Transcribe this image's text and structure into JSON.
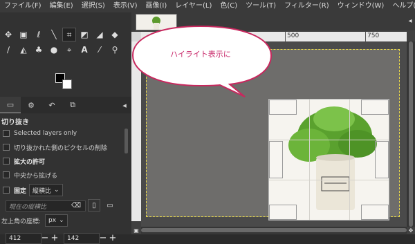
{
  "menubar": {
    "items": [
      "ファイル(F)",
      "編集(E)",
      "選択(S)",
      "表示(V)",
      "画像(I)",
      "レイヤー(L)",
      "色(C)",
      "ツール(T)",
      "フィルター(R)",
      "ウィンドウ(W)",
      "ヘルプ(H)"
    ]
  },
  "tool_options": {
    "title": "切り抜き",
    "selected_layers_only": "Selected layers only",
    "delete_cropped_pixels": "切り抜かれた側のピクセルの削除",
    "allow_growing": "拡大の許可",
    "expand_from_center": "中央から拡げる",
    "fixed_label": "固定",
    "fixed_value": "縦横比",
    "aspect_placeholder": "現在の縦横比",
    "position_label": "左上角の座標:",
    "unit": "px",
    "pos_x": "412",
    "pos_y": "142"
  },
  "ruler": {
    "label_500": "500",
    "label_750": "750"
  },
  "callout": {
    "text": "ハイライト表示に",
    "stroke_color": "#c8285e"
  },
  "icons": [
    "move-icon",
    "rect-select-icon",
    "lasso-icon",
    "fuzzy-select-icon",
    "crop-icon",
    "transform-icon",
    "warp-icon",
    "bucket-fill-icon",
    "paintbrush-icon",
    "eraser-icon",
    "clone-icon",
    "smudge-icon",
    "path-icon",
    "text-icon",
    "color-picker-icon",
    "zoom-icon"
  ]
}
